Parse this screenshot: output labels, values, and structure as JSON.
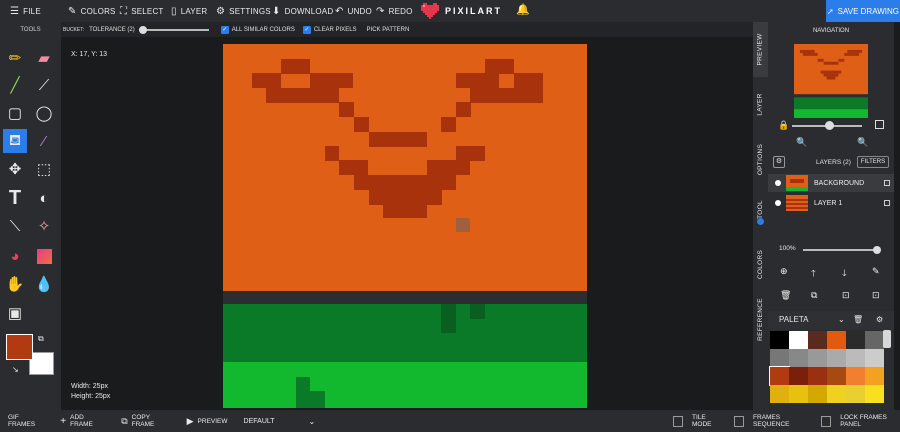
{
  "menu": {
    "file": "FILE",
    "colors": "COLORS",
    "select": "SELECT",
    "layer": "LAYER",
    "settings": "SETTINGS",
    "download": "DOWNLOAD",
    "undo": "UNDO",
    "redo": "REDO",
    "brand": "PIXILART",
    "save": "SAVE DRAWING"
  },
  "tools": {
    "label": "TOOLS"
  },
  "options": {
    "bucket": "BUCKET:",
    "tolerance": "TOLERANCE (2)",
    "all_similar": "ALL SIMILAR COLORS",
    "clear_pixels": "CLEAR PIXELS",
    "pick_pattern": "PICK PATTERN"
  },
  "canvas": {
    "coords": "X: 17, Y: 13",
    "width": "Width: 25px",
    "height": "Height: 25px"
  },
  "side_tabs": {
    "preview": "PREVIEW",
    "layer": "LAYER",
    "options": "OPTIONS",
    "tool": "TOOL",
    "colors": "COLORS",
    "reference": "REFERENCE"
  },
  "navigation": {
    "title": "NAVIGATION"
  },
  "layers": {
    "title": "LAYERS (2)",
    "filters": "FILTERS",
    "items": [
      {
        "name": "BACKGROUND"
      },
      {
        "name": "LAYER 1"
      }
    ],
    "opacity": "100%"
  },
  "palette": {
    "name": "PALETA",
    "colors": [
      "#000000",
      "#ffffff",
      "#5a2a1e",
      "#e05a10",
      "#2b2b2b",
      "#666666",
      "#777777",
      "#888888",
      "#999999",
      "#aaaaaa",
      "#bbbbbb",
      "#cccccc",
      "#b23a10",
      "#7a1f0a",
      "#9a3010",
      "#a84a10",
      "#f08030",
      "#f4a020",
      "#e0b010",
      "#e8c010",
      "#d4a800",
      "#f0d020",
      "#e8d030",
      "#f8e020"
    ]
  },
  "bottom": {
    "gif_frames": "GIF FRAMES",
    "add_frame": "ADD FRAME",
    "copy_frame": "COPY FRAME",
    "preview": "PREVIEW",
    "default": "DEFAULT",
    "tile_mode": "TILE MODE",
    "frames_sequence": "FRAMES SEQUENCE",
    "lock_frames_panel": "LOCK FRAMES PANEL"
  },
  "colors": {
    "accent": "#2b7de9",
    "primary_color": "#b23a10",
    "secondary_color": "#ffffff",
    "canvas_orange": "#e05f16",
    "canvas_dark": "#a8320c",
    "grass_dark": "#0a7a28",
    "grass_light": "#12b82e"
  }
}
